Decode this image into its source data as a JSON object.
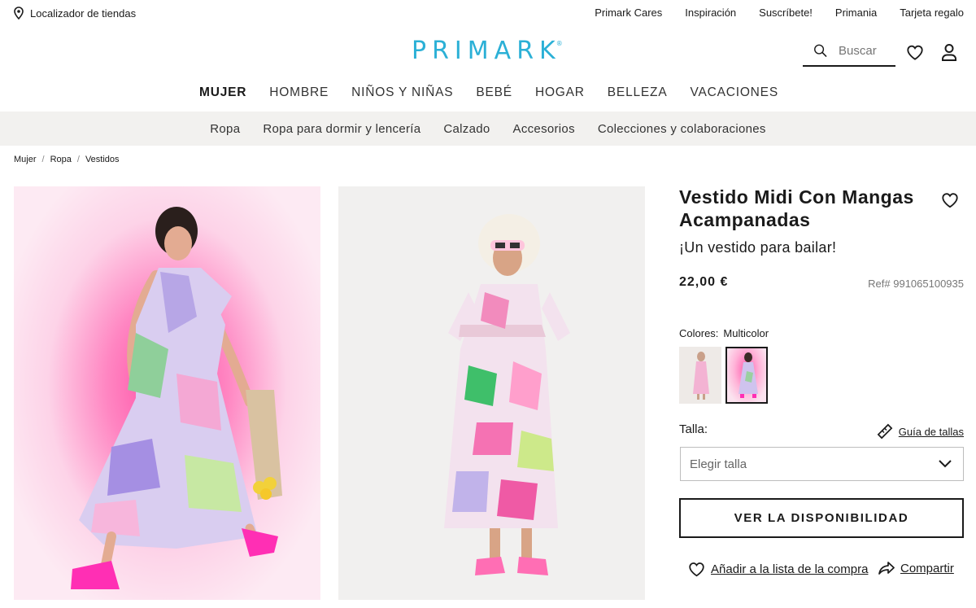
{
  "utility": {
    "store_locator": "Localizador de tiendas",
    "links": [
      "Primark Cares",
      "Inspiración",
      "Suscríbete!",
      "Primania",
      "Tarjeta regalo"
    ]
  },
  "header": {
    "logo": "PRIMARK",
    "search_placeholder": "Buscar"
  },
  "main_nav": [
    "MUJER",
    "HOMBRE",
    "NIÑOS Y NIÑAS",
    "BEBÉ",
    "HOGAR",
    "BELLEZA",
    "VACACIONES"
  ],
  "sub_nav": [
    "Ropa",
    "Ropa para dormir y lencería",
    "Calzado",
    "Accesorios",
    "Colecciones y colaboraciones"
  ],
  "breadcrumb": [
    "Mujer",
    "Ropa",
    "Vestidos"
  ],
  "product": {
    "title": "Vestido Midi Con Mangas Acampanadas",
    "subtitle": "¡Un vestido para bailar!",
    "price": "22,00 €",
    "ref": "Ref# 991065100935",
    "colors_label": "Colores:",
    "color_value": "Multicolor",
    "size_label": "Talla:",
    "size_guide": "Guía de tallas",
    "size_placeholder": "Elegir talla",
    "availability_button": "VER LA DISPONIBILIDAD",
    "add_to_list": "Añadir a la lista de la compra",
    "share": "Compartir"
  },
  "colors": {
    "brand": "#2bb0d6",
    "text": "#1a1a1a",
    "subnav_bg": "#f2f1ef",
    "accent_pink": "#ff4aa3"
  }
}
